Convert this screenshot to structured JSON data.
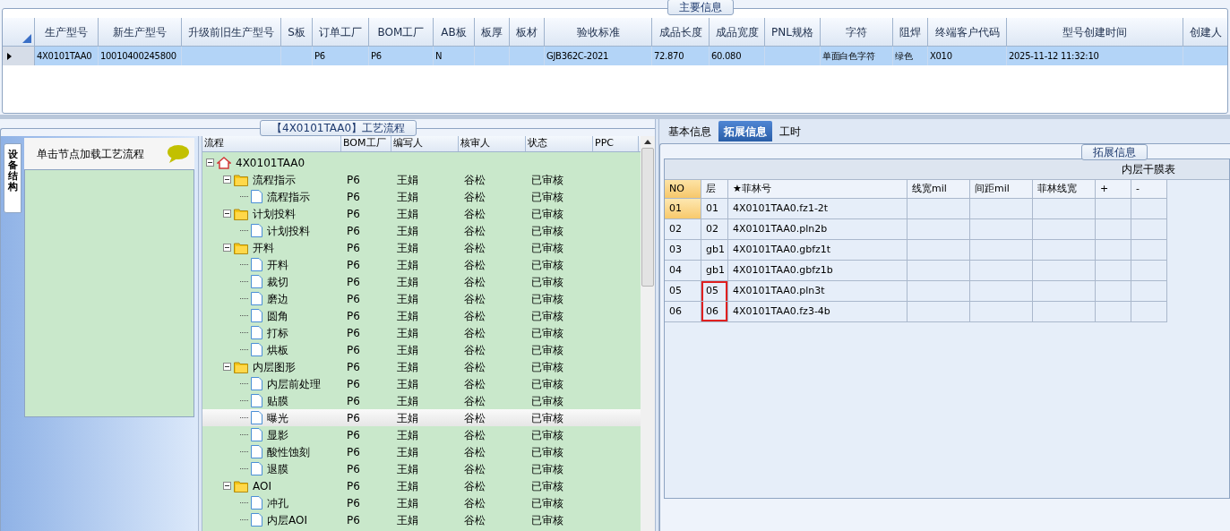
{
  "main_info": {
    "legend": "主要信息",
    "columns": [
      "生产型号",
      "新生产型号",
      "升级前旧生产型号",
      "S板",
      "订单工厂",
      "BOM工厂",
      "AB板",
      "板厚",
      "板材",
      "验收标准",
      "成品长度",
      "成品宽度",
      "PNL规格",
      "字符",
      "阻焊",
      "终端客户代码",
      "型号创建时间",
      "创建人"
    ],
    "rows": [
      {
        "selected": true,
        "cells": [
          "4X0101TAA0",
          "10010400245800",
          "",
          "",
          "P6",
          "P6",
          "N",
          "",
          "",
          "GJB362C-2021",
          "72.870",
          "60.080",
          "",
          "单面白色字符",
          "绿色",
          "X010",
          "2025-11-12 11:32:10",
          ""
        ]
      }
    ]
  },
  "process_flow": {
    "legend": "【4X0101TAA0】工艺流程",
    "side_tab": "设备结构",
    "hint": "单击节点加载工艺流程",
    "columns": [
      "流程",
      "BOM工厂",
      "编写人",
      "核审人",
      "状态",
      "PPC"
    ],
    "tree": [
      {
        "label": "4X0101TAA0",
        "kind": "home",
        "expanded": true,
        "selected": false,
        "children": [
          {
            "label": "流程指示",
            "kind": "folder",
            "expanded": true,
            "selected": false,
            "bom": "P6",
            "writer": "王娟",
            "reviewer": "谷松",
            "status": "已审核",
            "children": [
              {
                "label": "流程指示",
                "kind": "step",
                "selected": false,
                "bom": "P6",
                "writer": "王娟",
                "reviewer": "谷松",
                "status": "已审核"
              }
            ]
          },
          {
            "label": "计划投料",
            "kind": "folder",
            "expanded": true,
            "selected": false,
            "bom": "P6",
            "writer": "王娟",
            "reviewer": "谷松",
            "status": "已审核",
            "children": [
              {
                "label": "计划投料",
                "kind": "step",
                "selected": false,
                "bom": "P6",
                "writer": "王娟",
                "reviewer": "谷松",
                "status": "已审核"
              }
            ]
          },
          {
            "label": "开料",
            "kind": "folder",
            "expanded": true,
            "selected": false,
            "bom": "P6",
            "writer": "王娟",
            "reviewer": "谷松",
            "status": "已审核",
            "children": [
              {
                "label": "开料",
                "kind": "step",
                "selected": false,
                "bom": "P6",
                "writer": "王娟",
                "reviewer": "谷松",
                "status": "已审核"
              },
              {
                "label": "裁切",
                "kind": "step",
                "selected": false,
                "bom": "P6",
                "writer": "王娟",
                "reviewer": "谷松",
                "status": "已审核"
              },
              {
                "label": "磨边",
                "kind": "step",
                "selected": false,
                "bom": "P6",
                "writer": "王娟",
                "reviewer": "谷松",
                "status": "已审核"
              },
              {
                "label": "圆角",
                "kind": "step",
                "selected": false,
                "bom": "P6",
                "writer": "王娟",
                "reviewer": "谷松",
                "status": "已审核"
              },
              {
                "label": "打标",
                "kind": "step",
                "selected": false,
                "bom": "P6",
                "writer": "王娟",
                "reviewer": "谷松",
                "status": "已审核"
              },
              {
                "label": "烘板",
                "kind": "step",
                "selected": false,
                "bom": "P6",
                "writer": "王娟",
                "reviewer": "谷松",
                "status": "已审核"
              }
            ]
          },
          {
            "label": "内层图形",
            "kind": "folder",
            "expanded": true,
            "selected": false,
            "bom": "P6",
            "writer": "王娟",
            "reviewer": "谷松",
            "status": "已审核",
            "children": [
              {
                "label": "内层前处理",
                "kind": "step",
                "selected": false,
                "bom": "P6",
                "writer": "王娟",
                "reviewer": "谷松",
                "status": "已审核"
              },
              {
                "label": "贴膜",
                "kind": "step",
                "selected": false,
                "bom": "P6",
                "writer": "王娟",
                "reviewer": "谷松",
                "status": "已审核"
              },
              {
                "label": "曝光",
                "kind": "step",
                "selected": true,
                "bom": "P6",
                "writer": "王娟",
                "reviewer": "谷松",
                "status": "已审核"
              },
              {
                "label": "显影",
                "kind": "step",
                "selected": false,
                "bom": "P6",
                "writer": "王娟",
                "reviewer": "谷松",
                "status": "已审核"
              },
              {
                "label": "酸性蚀刻",
                "kind": "step",
                "selected": false,
                "bom": "P6",
                "writer": "王娟",
                "reviewer": "谷松",
                "status": "已审核"
              },
              {
                "label": "退膜",
                "kind": "step",
                "selected": false,
                "bom": "P6",
                "writer": "王娟",
                "reviewer": "谷松",
                "status": "已审核"
              }
            ]
          },
          {
            "label": "AOI",
            "kind": "folder",
            "expanded": true,
            "selected": false,
            "bom": "P6",
            "writer": "王娟",
            "reviewer": "谷松",
            "status": "已审核",
            "children": [
              {
                "label": "冲孔",
                "kind": "step",
                "selected": false,
                "bom": "P6",
                "writer": "王娟",
                "reviewer": "谷松",
                "status": "已审核"
              },
              {
                "label": "内层AOI",
                "kind": "step",
                "selected": false,
                "bom": "P6",
                "writer": "王娟",
                "reviewer": "谷松",
                "status": "已审核"
              }
            ]
          }
        ]
      }
    ]
  },
  "detail": {
    "tabs": [
      {
        "label": "基本信息",
        "selected": false
      },
      {
        "label": "拓展信息",
        "selected": true
      },
      {
        "label": "工时",
        "selected": false
      }
    ],
    "legend": "拓展信息",
    "table_title": "内层干膜表",
    "columns": [
      "NO",
      "层",
      "★菲林号",
      "线宽mil",
      "间距mil",
      "菲林线宽",
      "+",
      "-"
    ],
    "rows": [
      {
        "selected": true,
        "highlighted": false,
        "cells": [
          "01",
          "01",
          "4X0101TAA0.fz1-2t",
          "",
          "",
          "",
          "",
          ""
        ]
      },
      {
        "selected": false,
        "highlighted": false,
        "cells": [
          "02",
          "02",
          "4X0101TAA0.pln2b",
          "",
          "",
          "",
          "",
          ""
        ]
      },
      {
        "selected": false,
        "highlighted": false,
        "cells": [
          "03",
          "gb1",
          "4X0101TAA0.gbfz1t",
          "",
          "",
          "",
          "",
          ""
        ]
      },
      {
        "selected": false,
        "highlighted": false,
        "cells": [
          "04",
          "gb1",
          "4X0101TAA0.gbfz1b",
          "",
          "",
          "",
          "",
          ""
        ]
      },
      {
        "selected": false,
        "highlighted": true,
        "cells": [
          "05",
          "05",
          "4X0101TAA0.pln3t",
          "",
          "",
          "",
          "",
          ""
        ]
      },
      {
        "selected": false,
        "highlighted": true,
        "cells": [
          "06",
          "06",
          "4X0101TAA0.fz3-4b",
          "",
          "",
          "",
          "",
          ""
        ]
      }
    ]
  }
}
